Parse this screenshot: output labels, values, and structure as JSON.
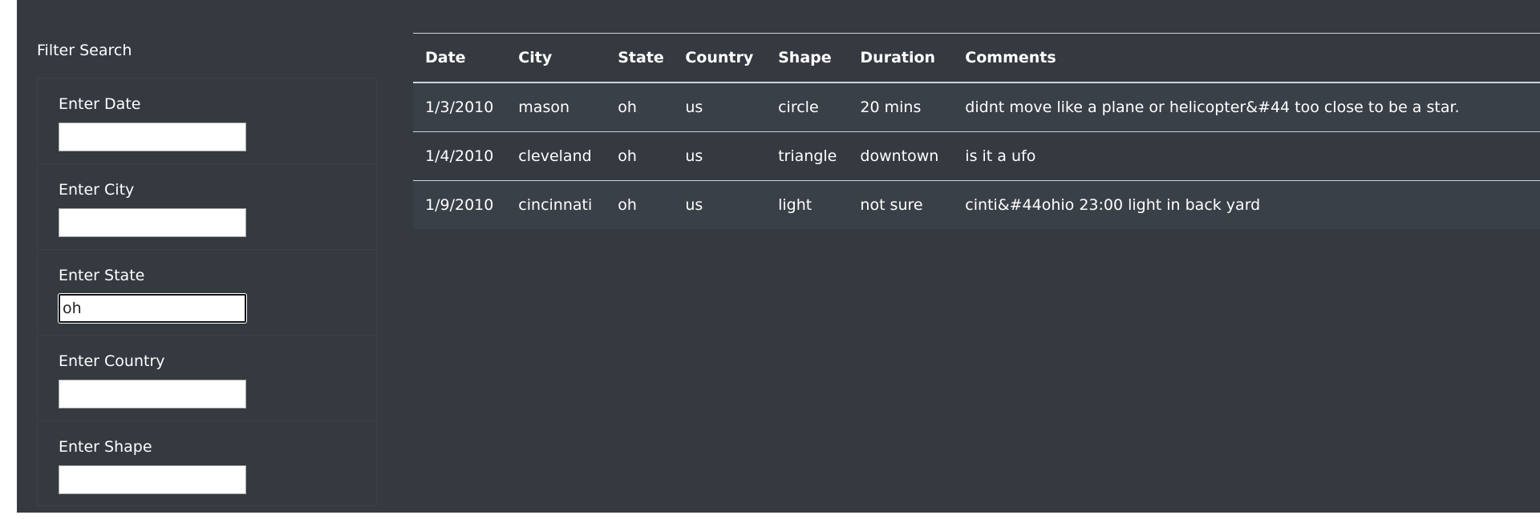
{
  "sidebar": {
    "title": "Filter Search",
    "filters": [
      {
        "label": "Enter Date",
        "value": ""
      },
      {
        "label": "Enter City",
        "value": ""
      },
      {
        "label": "Enter State",
        "value": "oh"
      },
      {
        "label": "Enter Country",
        "value": ""
      },
      {
        "label": "Enter Shape",
        "value": ""
      }
    ]
  },
  "table": {
    "headers": [
      "Date",
      "City",
      "State",
      "Country",
      "Shape",
      "Duration",
      "Comments"
    ],
    "rows": [
      [
        "1/3/2010",
        "mason",
        "oh",
        "us",
        "circle",
        "20 mins",
        "didnt move like a plane or helicopter&#44 too close to be a star."
      ],
      [
        "1/4/2010",
        "cleveland",
        "oh",
        "us",
        "triangle",
        "downtown",
        "is it a ufo"
      ],
      [
        "1/9/2010",
        "cincinnati",
        "oh",
        "us",
        "light",
        "not sure",
        "cinti&#44ohio 23:00 light in back yard"
      ]
    ]
  },
  "colors": {
    "background": "#343a40",
    "row_alt": "#3a4047",
    "text": "#ffffff"
  }
}
